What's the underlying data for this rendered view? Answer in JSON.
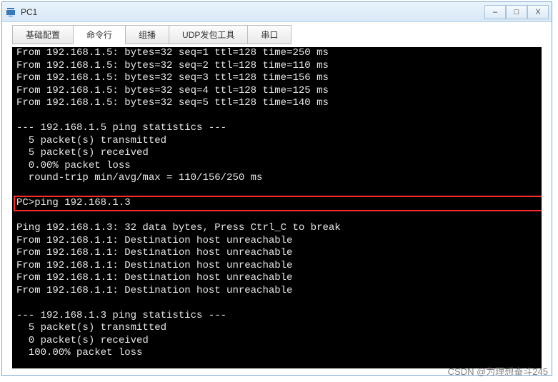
{
  "window": {
    "title": "PC1"
  },
  "tabs": {
    "items": [
      {
        "label": "基础配置"
      },
      {
        "label": "命令行"
      },
      {
        "label": "组播"
      },
      {
        "label": "UDP发包工具"
      },
      {
        "label": "串口"
      }
    ],
    "activeIndex": 1
  },
  "terminal": {
    "lines": [
      "From 192.168.1.5: bytes=32 seq=1 ttl=128 time=250 ms",
      "From 192.168.1.5: bytes=32 seq=2 ttl=128 time=110 ms",
      "From 192.168.1.5: bytes=32 seq=3 ttl=128 time=156 ms",
      "From 192.168.1.5: bytes=32 seq=4 ttl=128 time=125 ms",
      "From 192.168.1.5: bytes=32 seq=5 ttl=128 time=140 ms",
      "",
      "--- 192.168.1.5 ping statistics ---",
      "  5 packet(s) transmitted",
      "  5 packet(s) received",
      "  0.00% packet loss",
      "  round-trip min/avg/max = 110/156/250 ms",
      "",
      "PC>ping 192.168.1.3",
      "",
      "Ping 192.168.1.3: 32 data bytes, Press Ctrl_C to break",
      "From 192.168.1.1: Destination host unreachable",
      "From 192.168.1.1: Destination host unreachable",
      "From 192.168.1.1: Destination host unreachable",
      "From 192.168.1.1: Destination host unreachable",
      "From 192.168.1.1: Destination host unreachable",
      "",
      "--- 192.168.1.3 ping statistics ---",
      "  5 packet(s) transmitted",
      "  0 packet(s) received",
      "  100.00% packet loss",
      ""
    ],
    "prompt": "PC>",
    "highlight_line_index": 12
  },
  "watermark": "CSDN @为理想奋斗245"
}
